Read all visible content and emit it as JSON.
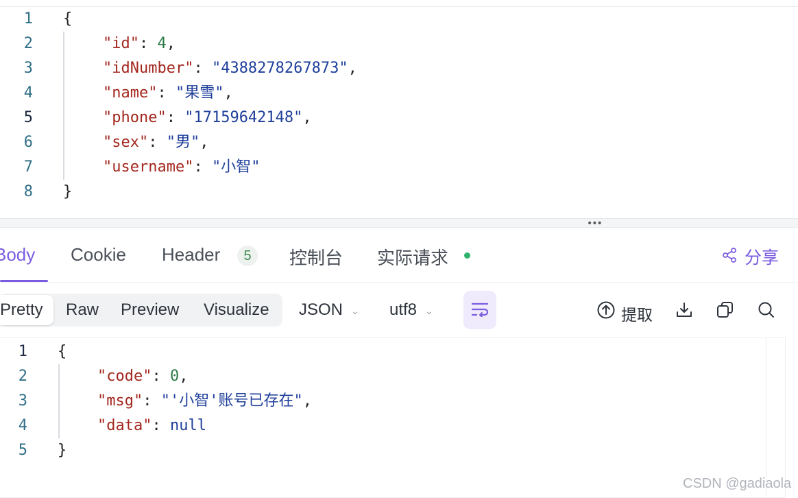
{
  "request_editor": {
    "line_numbers": [
      "1",
      "2",
      "3",
      "4",
      "5",
      "6",
      "7",
      "8"
    ],
    "lines": [
      {
        "open": "{"
      },
      {
        "key": "\"id\"",
        "colon": ": ",
        "value": "4",
        "value_type": "number",
        "trail": ","
      },
      {
        "key": "\"idNumber\"",
        "colon": ": ",
        "value": "\"4388278267873\"",
        "value_type": "string",
        "trail": ","
      },
      {
        "key": "\"name\"",
        "colon": ": ",
        "value": "\"果雪\"",
        "value_type": "string",
        "trail": ","
      },
      {
        "key": "\"phone\"",
        "colon": ": ",
        "value": "\"17159642148\"",
        "value_type": "string",
        "trail": ","
      },
      {
        "key": "\"sex\"",
        "colon": ": ",
        "value": "\"男\"",
        "value_type": "string",
        "trail": ","
      },
      {
        "key": "\"username\"",
        "colon": ": ",
        "value": "\"小智\"",
        "value_type": "string",
        "trail": ""
      },
      {
        "close": "}"
      }
    ]
  },
  "splitter": {
    "handle": "•••"
  },
  "response_tabs": {
    "body": "Body",
    "cookie": "Cookie",
    "header": "Header",
    "header_count": "5",
    "console": "控制台",
    "actual_request": "实际请求",
    "share": "分享"
  },
  "toolbar": {
    "pretty": "Pretty",
    "raw": "Raw",
    "preview": "Preview",
    "visualize": "Visualize",
    "format": "JSON",
    "encoding": "utf8",
    "extract": "提取"
  },
  "response_body": {
    "line_numbers": [
      "1",
      "2",
      "3",
      "4",
      "5"
    ],
    "open": "{",
    "code_key": "\"code\"",
    "code_value": "0",
    "msg_key": "\"msg\"",
    "msg_value": "\"'小智'账号已存在\"",
    "data_key": "\"data\"",
    "data_value": "null",
    "close": "}"
  },
  "watermark": "CSDN @gadiaola",
  "colors": {
    "accent": "#7b5ce0",
    "json_key": "#a3281f",
    "json_string": "#1f3f9a",
    "json_number": "#2a7a45",
    "status_dot": "#2fb36a"
  }
}
